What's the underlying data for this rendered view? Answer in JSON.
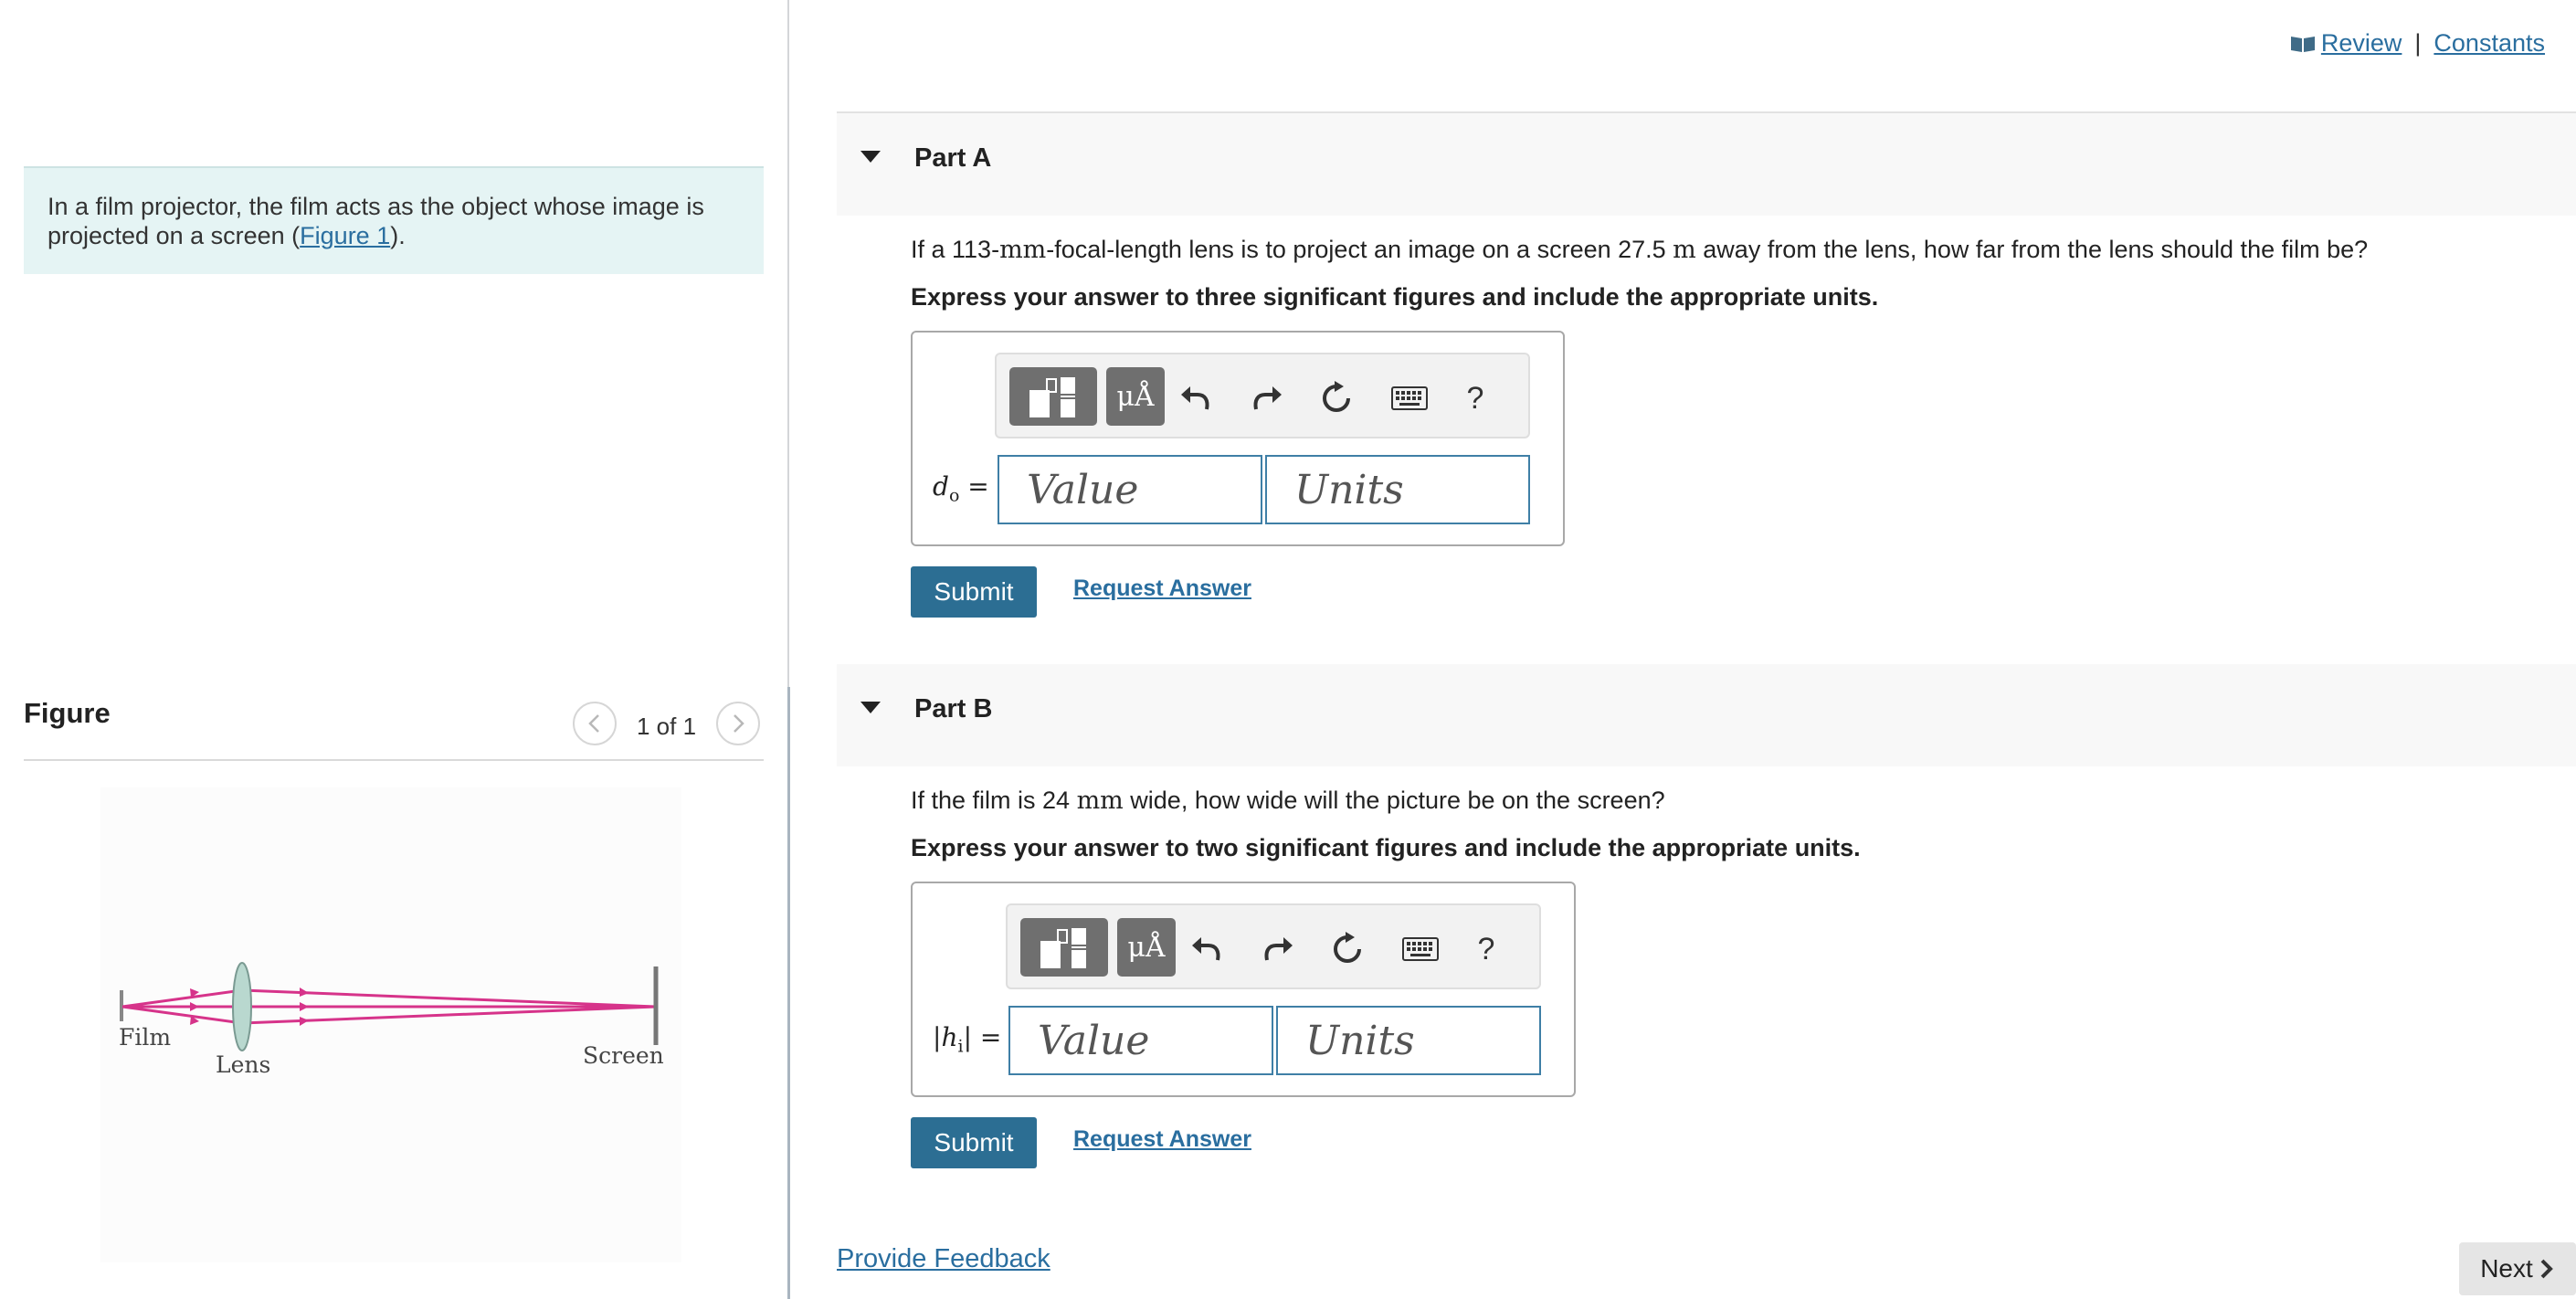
{
  "header": {
    "review_label": "Review",
    "separator": "|",
    "constants_label": "Constants"
  },
  "intro": {
    "text_before": "In a film projector, the film acts as the object whose image is projected on a screen (",
    "link": "Figure 1",
    "text_after": ")."
  },
  "figure": {
    "heading": "Figure",
    "counter": "1 of 1",
    "labels": {
      "film": "Film",
      "lens": "Lens",
      "screen": "Screen"
    }
  },
  "part_a": {
    "title": "Part A",
    "question_pre": "If a 113-",
    "question_unit1": "mm",
    "question_mid": "-focal-length lens is to project an image on a screen 27.5 ",
    "question_unit2": "m",
    "question_post": " away from the lens, how far from the lens should the film be?",
    "instruction": "Express your answer to three significant figures and include the appropriate units.",
    "variable": "d",
    "variable_sub": "o",
    "equals": "=",
    "value_placeholder": "Value",
    "units_placeholder": "Units",
    "submit_label": "Submit",
    "request_label": "Request Answer"
  },
  "part_b": {
    "title": "Part B",
    "question_pre": "If the film is 24 ",
    "question_unit": "mm",
    "question_post": " wide, how wide will the picture be on the screen?",
    "instruction": "Express your answer to two significant figures and include the appropriate units.",
    "variable_open": "|",
    "variable": "h",
    "variable_sub": "i",
    "variable_close": "|",
    "equals": "=",
    "value_placeholder": "Value",
    "units_placeholder": "Units",
    "submit_label": "Submit",
    "request_label": "Request Answer"
  },
  "toolbar": {
    "units_symbol": "μÅ",
    "help_symbol": "?"
  },
  "footer": {
    "feedback_label": "Provide Feedback",
    "next_label": "Next"
  },
  "colors": {
    "accent": "#2c6e93",
    "link": "#2a6e9f",
    "intro_bg": "#e5f4f4",
    "ray": "#d6338a"
  },
  "icons": [
    "book-icon",
    "caret-down-icon",
    "templates-icon",
    "undo-icon",
    "redo-icon",
    "reset-icon",
    "keyboard-icon",
    "chevron-left-icon",
    "chevron-right-icon"
  ]
}
